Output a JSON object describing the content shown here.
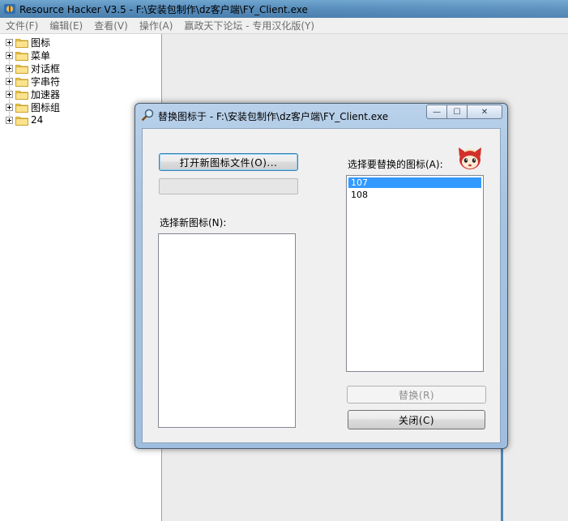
{
  "window": {
    "title": "Resource Hacker V3.5  -  F:\\安装包制作\\dz客户端\\FY_Client.exe"
  },
  "menu": {
    "items": [
      "文件(F)",
      "编辑(E)",
      "查看(V)",
      "操作(A)",
      "赢政天下论坛 - 专用汉化版(Y)"
    ]
  },
  "tree": {
    "items": [
      {
        "label": "图标"
      },
      {
        "label": "菜单"
      },
      {
        "label": "对话框"
      },
      {
        "label": "字串符"
      },
      {
        "label": "加速器"
      },
      {
        "label": "图标组"
      },
      {
        "label": "24"
      }
    ]
  },
  "dialog": {
    "title": "替换图标于 - F:\\安装包制作\\dz客户端\\FY_Client.exe",
    "open_button": "打开新图标文件(O)...",
    "select_new_label": "选择新图标(N):",
    "select_replace_label": "选择要替换的图标(A):",
    "replace_list": [
      "107",
      "108"
    ],
    "selected_index": 0,
    "replace_button": "替换(R)",
    "close_button": "关闭(C)",
    "caption": {
      "minimize": "—",
      "maximize": "☐",
      "close": "✕"
    }
  },
  "colors": {
    "selection": "#3399ff",
    "titlebar": "#5a8fbd",
    "dialog_frame": "#a6c3e2"
  }
}
